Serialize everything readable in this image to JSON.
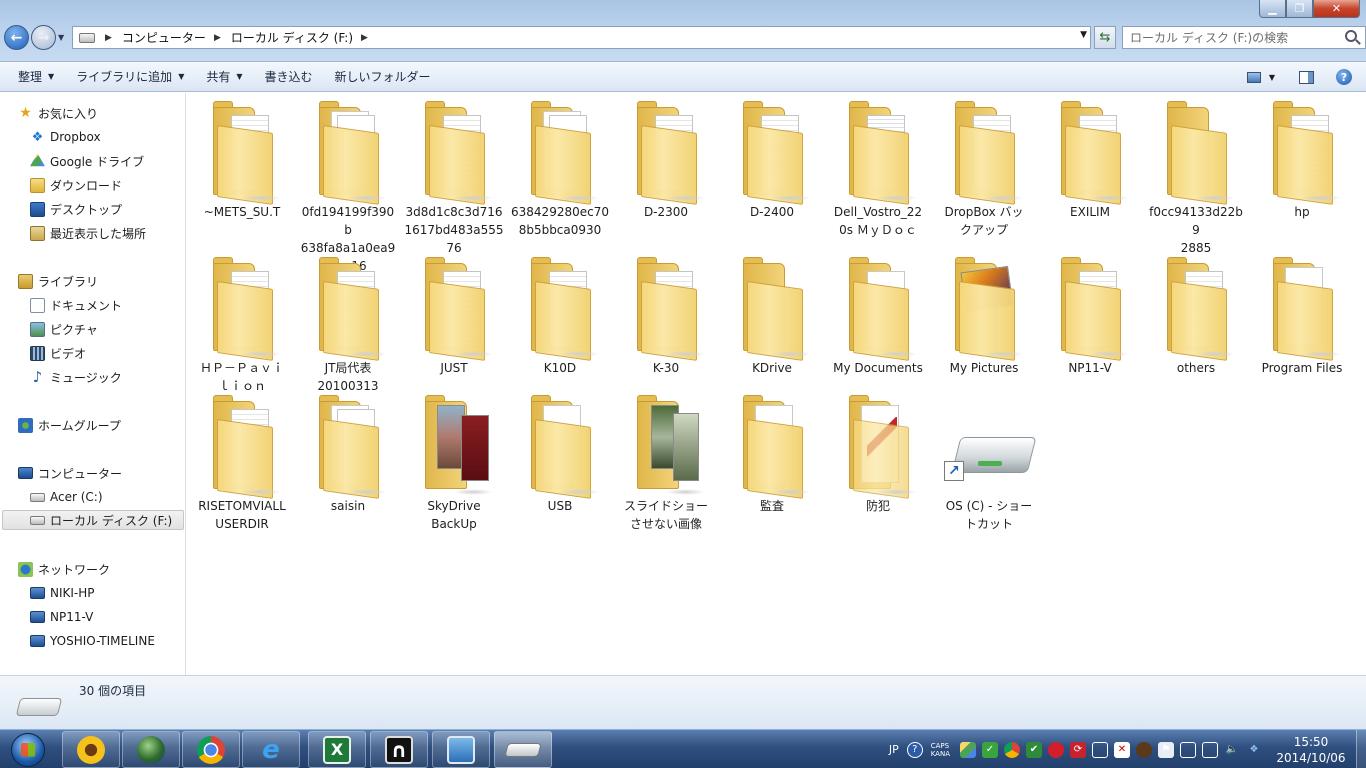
{
  "window": {
    "minimize_glyph": "▁",
    "maximize_glyph": "❐",
    "close_glyph": "✕"
  },
  "address": {
    "crumbs": [
      "コンピューター",
      "ローカル ディスク (F:)"
    ],
    "search_placeholder": "ローカル ディスク (F:)の検索"
  },
  "toolbar": {
    "organize": "整理",
    "add_to_library": "ライブラリに追加",
    "share": "共有",
    "burn": "書き込む",
    "new_folder": "新しいフォルダー"
  },
  "sidebar": {
    "favorites": {
      "label": "お気に入り",
      "items": [
        "Dropbox",
        "Google ドライブ",
        "ダウンロード",
        "デスクトップ",
        "最近表示した場所"
      ]
    },
    "libraries": {
      "label": "ライブラリ",
      "items": [
        "ドキュメント",
        "ピクチャ",
        "ビデオ",
        "ミュージック"
      ]
    },
    "homegroup": {
      "label": "ホームグループ"
    },
    "computer": {
      "label": "コンピューター",
      "items": [
        "Acer (C:)",
        "ローカル ディスク (F:)"
      ]
    },
    "network": {
      "label": "ネットワーク",
      "items": [
        "NIKI-HP",
        "NP11-V",
        "YOSHIO-TIMELINE"
      ]
    }
  },
  "items": [
    "~METS_SU.T",
    "0fd194199f390b638fa8a1a0ea9aaa16",
    "3d8d1c8c3d7161617bd483a55576",
    "638429280ec708b5bbca0930",
    "D-2300",
    "D-2400",
    "Dell_Vostro_220s MyDoc",
    "DropBox バックアップ",
    "EXILIM",
    "f0cc94133d22b92885",
    "hp",
    "HP-Pavilion",
    "JT局代表20100313",
    "JUST",
    "K10D",
    "K-30",
    "KDrive",
    "My Documents",
    "My Pictures",
    "NP11-V",
    "others",
    "Program Files",
    "RISETOMVIALLUSERDIR",
    "saisin",
    "SkyDrive BackUp",
    "USB",
    "スライドショーさせない画像",
    "監査",
    "防犯",
    "OS (C) - ショートカット"
  ],
  "labels": {
    "l0": "~METS_SU.T",
    "l1a": "0fd194199f390b",
    "l1b": "638fa8a1a0ea9",
    "l1c": "aaa16",
    "l2a": "3d8d1c8c3d716",
    "l2b": "1617bd483a555",
    "l2c": "76",
    "l3a": "638429280ec70",
    "l3b": "8b5bbca0930",
    "l4": "D-2300",
    "l5": "D-2400",
    "l6a": "Dell_Vostro_22",
    "l6b": "0s ＭｙＤｏｃ",
    "l7a": "DropBox バッ",
    "l7b": "クアップ",
    "l8": "EXILIM",
    "l9a": "f0cc94133d22b9",
    "l9b": "2885",
    "l10": "hp",
    "l11a": "ＨＰ－Ｐａｖｉ",
    "l11b": "ｌｉｏｎ",
    "l12a": "JT局代表",
    "l12b": "20100313",
    "l13": "JUST",
    "l14": "K10D",
    "l15": "K-30",
    "l16": "KDrive",
    "l17": "My Documents",
    "l18": "My Pictures",
    "l19": "NP11-V",
    "l20": "others",
    "l21": "Program Files",
    "l22a": "RISETOMVIALL",
    "l22b": "USERDIR",
    "l23": "saisin",
    "l24a": "SkyDrive",
    "l24b": "BackUp",
    "l25": "USB",
    "l26a": "スライドショー",
    "l26b": "させない画像",
    "l27": "監査",
    "l28": "防犯",
    "l29a": "OS (C) - ショー",
    "l29b": "トカット"
  },
  "status": {
    "item_count": "30 個の項目"
  },
  "taskbar": {
    "lang": "JP",
    "caps_line1": "CAPS",
    "caps_line2": "KANA",
    "time": "15:50",
    "date": "2014/10/06",
    "excel_glyph": "X",
    "ie_glyph": "e",
    "help_glyph": "?"
  },
  "colors": {
    "taskbar": "#2f4f7f",
    "folder": "#f2d271",
    "accent": "#1d5fb9"
  }
}
